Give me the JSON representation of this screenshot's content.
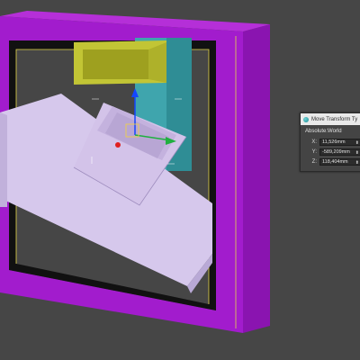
{
  "dialog": {
    "title": "Move Transform Ty",
    "group_label": "Absolute:World",
    "fields": [
      {
        "axis": "X:",
        "value": "11,526mm"
      },
      {
        "axis": "Y:",
        "value": "-589,209mm"
      },
      {
        "axis": "Z:",
        "value": "118,404mm"
      }
    ],
    "spinner_glyph": "⬍"
  },
  "colors": {
    "viewport_bg": "#464646",
    "frame_outer": "#a61ed0",
    "frame_inner_dark": "#111111",
    "frame_highlight": "#e5d94a",
    "ramp": "#d6c8ec",
    "yellow_box": "#c2c535",
    "cyan_panel": "#3fa5ad",
    "gizmo_blue": "#1447ff",
    "gizmo_green": "#20b040",
    "gizmo_red": "#e02020"
  }
}
